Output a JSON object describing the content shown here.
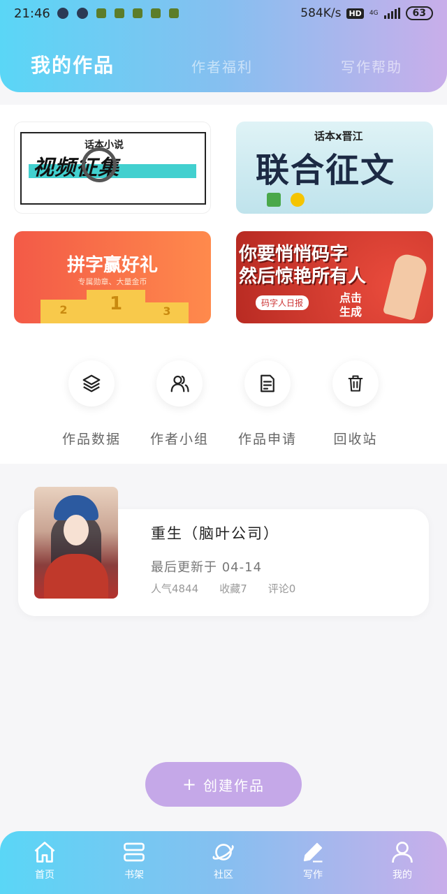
{
  "status_bar": {
    "time": "21:46",
    "net_speed": "584K/s",
    "hd": "HD",
    "network": "4G",
    "battery": "63"
  },
  "tabs": [
    {
      "label": "我的作品",
      "active": true
    },
    {
      "label": "作者福利",
      "active": false
    },
    {
      "label": "写作帮助",
      "active": false
    }
  ],
  "banners": {
    "b1": {
      "subtitle": "话本小说",
      "title": "视频征集"
    },
    "b2": {
      "top": "话本x晋江",
      "title": "联合征文"
    },
    "b3": {
      "title": "拼字赢好礼",
      "subtitle": "专属勋章、大量金币",
      "podium": [
        "2",
        "1",
        "3"
      ]
    },
    "b4": {
      "line1": "你要悄悄码字",
      "line2": "然后惊艳所有人",
      "daily": "码字人日报",
      "click": "点击\n生成"
    }
  },
  "actions": [
    {
      "label": "作品数据",
      "icon": "layers-icon"
    },
    {
      "label": "作者小组",
      "icon": "users-icon"
    },
    {
      "label": "作品申请",
      "icon": "document-icon"
    },
    {
      "label": "回收站",
      "icon": "trash-icon"
    }
  ],
  "work": {
    "title": "重生（脑叶公司）",
    "updated": "最后更新于 04-14",
    "popularity": "人气4844",
    "favorites": "收藏7",
    "comments": "评论0"
  },
  "create_button": {
    "label": "创建作品",
    "icon": "plus-icon"
  },
  "bottom_nav": [
    {
      "label": "首页",
      "icon": "home-icon"
    },
    {
      "label": "书架",
      "icon": "bookshelf-icon"
    },
    {
      "label": "社区",
      "icon": "planet-icon"
    },
    {
      "label": "写作",
      "icon": "pen-icon",
      "active": true
    },
    {
      "label": "我的",
      "icon": "user-icon"
    }
  ],
  "colors": {
    "gradient_start": "#5ad6f6",
    "gradient_end": "#c9aeea",
    "create_button": "#c5a8e8"
  }
}
